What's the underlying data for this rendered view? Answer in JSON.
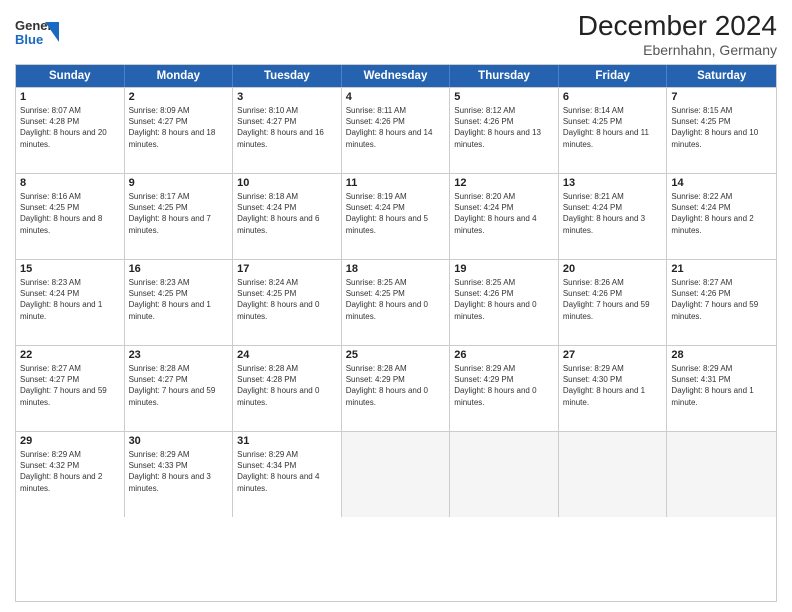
{
  "logo": {
    "general": "General",
    "blue": "Blue"
  },
  "title": "December 2024",
  "subtitle": "Ebernhahn, Germany",
  "days": [
    "Sunday",
    "Monday",
    "Tuesday",
    "Wednesday",
    "Thursday",
    "Friday",
    "Saturday"
  ],
  "weeks": [
    [
      {
        "day": "1",
        "sunrise": "8:07 AM",
        "sunset": "4:28 PM",
        "daylight": "8 hours and 20 minutes"
      },
      {
        "day": "2",
        "sunrise": "8:09 AM",
        "sunset": "4:27 PM",
        "daylight": "8 hours and 18 minutes"
      },
      {
        "day": "3",
        "sunrise": "8:10 AM",
        "sunset": "4:27 PM",
        "daylight": "8 hours and 16 minutes"
      },
      {
        "day": "4",
        "sunrise": "8:11 AM",
        "sunset": "4:26 PM",
        "daylight": "8 hours and 14 minutes"
      },
      {
        "day": "5",
        "sunrise": "8:12 AM",
        "sunset": "4:26 PM",
        "daylight": "8 hours and 13 minutes"
      },
      {
        "day": "6",
        "sunrise": "8:14 AM",
        "sunset": "4:25 PM",
        "daylight": "8 hours and 11 minutes"
      },
      {
        "day": "7",
        "sunrise": "8:15 AM",
        "sunset": "4:25 PM",
        "daylight": "8 hours and 10 minutes"
      }
    ],
    [
      {
        "day": "8",
        "sunrise": "8:16 AM",
        "sunset": "4:25 PM",
        "daylight": "8 hours and 8 minutes"
      },
      {
        "day": "9",
        "sunrise": "8:17 AM",
        "sunset": "4:25 PM",
        "daylight": "8 hours and 7 minutes"
      },
      {
        "day": "10",
        "sunrise": "8:18 AM",
        "sunset": "4:24 PM",
        "daylight": "8 hours and 6 minutes"
      },
      {
        "day": "11",
        "sunrise": "8:19 AM",
        "sunset": "4:24 PM",
        "daylight": "8 hours and 5 minutes"
      },
      {
        "day": "12",
        "sunrise": "8:20 AM",
        "sunset": "4:24 PM",
        "daylight": "8 hours and 4 minutes"
      },
      {
        "day": "13",
        "sunrise": "8:21 AM",
        "sunset": "4:24 PM",
        "daylight": "8 hours and 3 minutes"
      },
      {
        "day": "14",
        "sunrise": "8:22 AM",
        "sunset": "4:24 PM",
        "daylight": "8 hours and 2 minutes"
      }
    ],
    [
      {
        "day": "15",
        "sunrise": "8:23 AM",
        "sunset": "4:24 PM",
        "daylight": "8 hours and 1 minute"
      },
      {
        "day": "16",
        "sunrise": "8:23 AM",
        "sunset": "4:25 PM",
        "daylight": "8 hours and 1 minute"
      },
      {
        "day": "17",
        "sunrise": "8:24 AM",
        "sunset": "4:25 PM",
        "daylight": "8 hours and 0 minutes"
      },
      {
        "day": "18",
        "sunrise": "8:25 AM",
        "sunset": "4:25 PM",
        "daylight": "8 hours and 0 minutes"
      },
      {
        "day": "19",
        "sunrise": "8:25 AM",
        "sunset": "4:26 PM",
        "daylight": "8 hours and 0 minutes"
      },
      {
        "day": "20",
        "sunrise": "8:26 AM",
        "sunset": "4:26 PM",
        "daylight": "7 hours and 59 minutes"
      },
      {
        "day": "21",
        "sunrise": "8:27 AM",
        "sunset": "4:26 PM",
        "daylight": "7 hours and 59 minutes"
      }
    ],
    [
      {
        "day": "22",
        "sunrise": "8:27 AM",
        "sunset": "4:27 PM",
        "daylight": "7 hours and 59 minutes"
      },
      {
        "day": "23",
        "sunrise": "8:28 AM",
        "sunset": "4:27 PM",
        "daylight": "7 hours and 59 minutes"
      },
      {
        "day": "24",
        "sunrise": "8:28 AM",
        "sunset": "4:28 PM",
        "daylight": "8 hours and 0 minutes"
      },
      {
        "day": "25",
        "sunrise": "8:28 AM",
        "sunset": "4:29 PM",
        "daylight": "8 hours and 0 minutes"
      },
      {
        "day": "26",
        "sunrise": "8:29 AM",
        "sunset": "4:29 PM",
        "daylight": "8 hours and 0 minutes"
      },
      {
        "day": "27",
        "sunrise": "8:29 AM",
        "sunset": "4:30 PM",
        "daylight": "8 hours and 1 minute"
      },
      {
        "day": "28",
        "sunrise": "8:29 AM",
        "sunset": "4:31 PM",
        "daylight": "8 hours and 1 minute"
      }
    ],
    [
      {
        "day": "29",
        "sunrise": "8:29 AM",
        "sunset": "4:32 PM",
        "daylight": "8 hours and 2 minutes"
      },
      {
        "day": "30",
        "sunrise": "8:29 AM",
        "sunset": "4:33 PM",
        "daylight": "8 hours and 3 minutes"
      },
      {
        "day": "31",
        "sunrise": "8:29 AM",
        "sunset": "4:34 PM",
        "daylight": "8 hours and 4 minutes"
      },
      null,
      null,
      null,
      null
    ]
  ]
}
